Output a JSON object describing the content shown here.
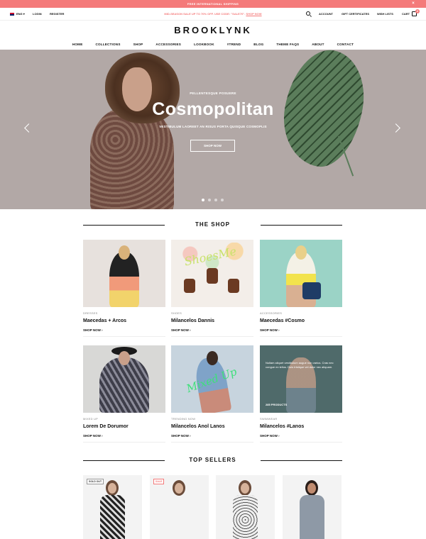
{
  "announcement": {
    "text": "FREE INTERNATIONAL SHIPPING",
    "close": "×"
  },
  "topbar": {
    "language": "ENG",
    "login": "LOGIN",
    "register": "REGISTER",
    "promo_prefix": "MID-SEASON SALE UP TO 70% OFF. USE CODE: \"SALE70\".",
    "promo_link": "SHOP NOW",
    "account": "ACCOUNT",
    "gift": "GIFT CERTIFICATES",
    "wishlists": "WISH LISTS",
    "cart": "CART",
    "cart_count": "0"
  },
  "logo": "BROOKLYNK",
  "nav": [
    "HOME",
    "COLLECTIONS",
    "SHOP",
    "ACCESSORIES",
    "LOOKBOOK",
    "#TREND",
    "BLOG",
    "THEME FAQS",
    "ABOUT",
    "CONTACT"
  ],
  "hero": {
    "eyebrow": "PELLENTESQUE POSUERE",
    "title": "Cosmopolitan",
    "subtitle": "VESTIBULUM LAOREET AN RISUS PORTA QUISQUE COSMOPLIS",
    "cta": "SHOP NOW",
    "slides": 4,
    "active_slide": 1
  },
  "shop": {
    "title": "THE SHOP",
    "tiles": [
      {
        "category": "DRESSES",
        "name": "Maecedas + Arcos",
        "link": "SHOP NOW"
      },
      {
        "category": "SHOES",
        "name": "Milancelos Dannis",
        "link": "SHOP NOW",
        "art_text": "ShoesMe"
      },
      {
        "category": "ACCESSORIES",
        "name": "Maecedas #Cosmo",
        "link": "SHOP NOW"
      },
      {
        "category": "MIXED UP",
        "name": "Lorem De Dorumor",
        "link": "SHOP NOW"
      },
      {
        "category": "TRENDING NOW",
        "name": "Milancelos Anol Lanos",
        "link": "SHOP NOW",
        "art_text": "Mixed Up"
      },
      {
        "category": "SWIMWEAR",
        "name": "Milancelos #Lanos",
        "link": "SHOP NOW",
        "overlay": "Nullam aliquet vestibulum augue non varius. Cras nec congue ex tellus. Duis tristique vel dolor nec aliquam.",
        "count": "285 PRODUCTS"
      }
    ]
  },
  "sellers": {
    "title": "TOP SELLERS",
    "items": [
      {
        "badge": "SOLD OUT"
      },
      {
        "badge": "SALE"
      },
      {
        "badge": ""
      },
      {
        "badge": ""
      }
    ]
  },
  "colors": {
    "accent": "#f47a7a",
    "hero_bg": "#b2a8a6"
  }
}
